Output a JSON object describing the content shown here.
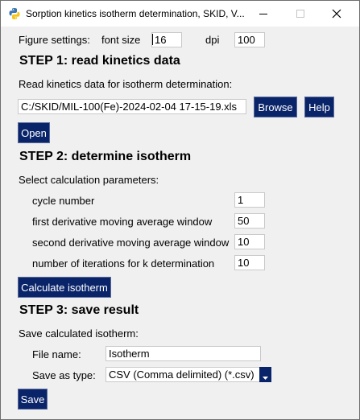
{
  "window": {
    "title": "Sorption kinetics isotherm determination, SKID, V..."
  },
  "figure_settings": {
    "label": "Figure settings:",
    "font_size_label": "font size",
    "font_size_value": "16",
    "dpi_label": "dpi",
    "dpi_value": "100"
  },
  "step1": {
    "heading": "STEP 1: read kinetics data",
    "description": "Read kinetics data for isotherm determination:",
    "file_path": "C:/SKID/MIL-100(Fe)-2024-02-04 17-15-19.xls",
    "browse_label": "Browse",
    "help_label": "Help",
    "open_label": "Open"
  },
  "step2": {
    "heading": "STEP 2: determine isotherm",
    "description": "Select calculation parameters:",
    "params": [
      {
        "label": "cycle number",
        "value": "1"
      },
      {
        "label": "first derivative moving average window",
        "value": "50"
      },
      {
        "label": "second derivative moving average window",
        "value": "10"
      },
      {
        "label": "number of iterations for k determination",
        "value": "10"
      }
    ],
    "calculate_label": "Calculate isotherm"
  },
  "step3": {
    "heading": "STEP 3: save result",
    "description": "Save calculated isotherm:",
    "file_name_label": "File name:",
    "file_name_value": "Isotherm",
    "save_type_label": "Save as type:",
    "save_type_value": "CSV (Comma delimited) (*.csv)",
    "save_label": "Save"
  },
  "icons": {
    "app": "python-icon",
    "minimize": "minimize-icon",
    "maximize": "maximize-icon",
    "close": "close-icon",
    "dropdown": "chevron-down-icon"
  }
}
